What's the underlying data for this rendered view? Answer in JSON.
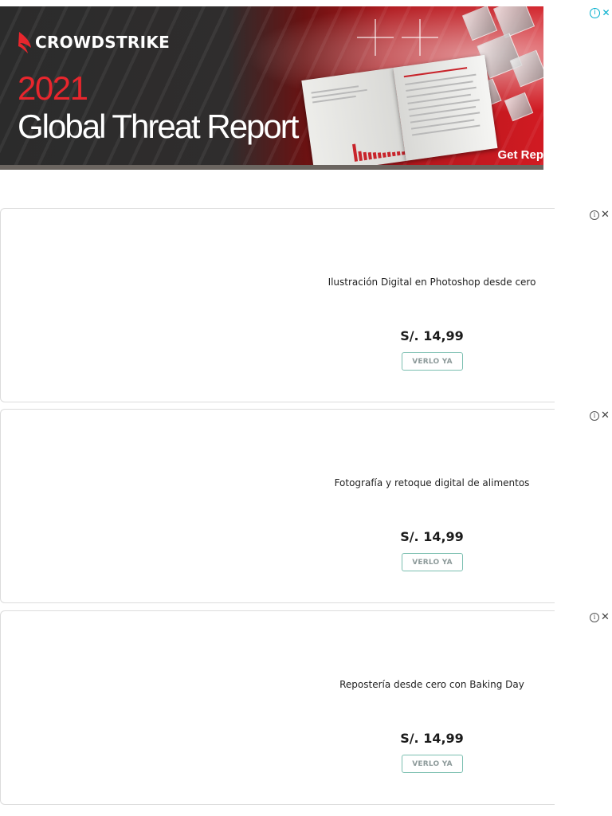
{
  "banner": {
    "brand": "CROWDSTRIKE",
    "year": "2021",
    "headline": "Global Threat Report",
    "cta": "Get Rep",
    "colors": {
      "accent_red": "#e8262d",
      "dark": "#2b2b2b"
    }
  },
  "adchoices": {
    "info_glyph": "i",
    "close_glyph": "✕"
  },
  "cards": [
    {
      "title": "Ilustración Digital en Photoshop desde cero",
      "price": "S/. 14,99",
      "button": "VERLO YA"
    },
    {
      "title": "Fotografía y retoque digital de alimentos",
      "price": "S/. 14,99",
      "button": "VERLO YA"
    },
    {
      "title": "Repostería desde cero con Baking Day",
      "price": "S/. 14,99",
      "button": "VERLO YA"
    }
  ],
  "card_controls": {
    "info_glyph": "i",
    "close_glyph": "✕"
  }
}
